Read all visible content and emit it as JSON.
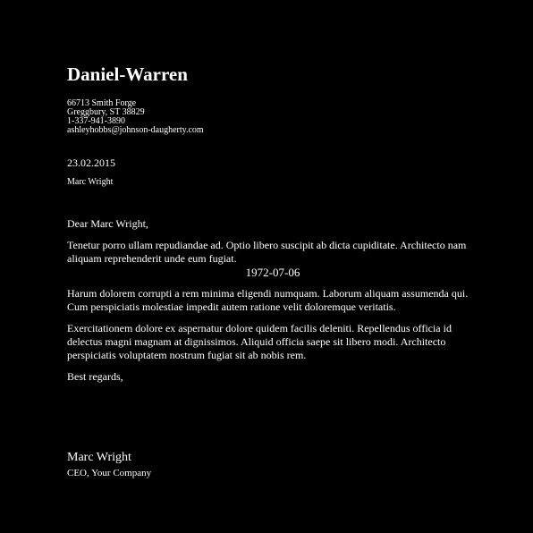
{
  "letter": {
    "company_name": "Daniel-Warren",
    "address": {
      "street": "66713 Smith Forge",
      "city_line": "Greggbury, ST 38829",
      "phone": "1-337-941-3890",
      "email": "ashleyhobbs@johnson-daugherty.com"
    },
    "date": "23.02.2015",
    "recipient": "Marc Wright",
    "salutation": "Dear Marc Wright,",
    "paragraph_1": "Tenetur porro ullam repudiandae ad. Optio libero suscipit ab dicta cupiditate. Architecto nam aliquam reprehenderit unde eum fugiat.",
    "centered_date": "1972-07-06",
    "paragraph_2": "Harum dolorem corrupti a rem minima eligendi numquam. Laborum aliquam assumenda qui. Cum perspiciatis molestiae impedit autem ratione velit doloremque veritatis.",
    "paragraph_3": "Exercitationem dolore ex aspernatur dolore quidem facilis deleniti. Repellendus officia id delectus magni magnam at dignissimos. Aliquid officia saepe sit libero modi. Architecto perspiciatis voluptatem nostrum fugiat sit ab nobis rem.",
    "closing": "Best regards,",
    "signature_name": "Marc Wright",
    "signature_title": "CEO, Your Company"
  },
  "colors": {
    "background": "#000000",
    "text": "#ffffff"
  }
}
